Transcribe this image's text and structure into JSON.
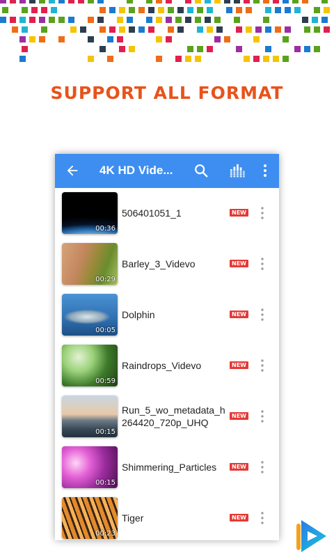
{
  "banner": {
    "headline": "SUPPORT ALL FORMAT"
  },
  "colors": {
    "headline": "#e8531b",
    "appbar": "#3d8ef0",
    "badge": "#e53935",
    "mosaic": [
      "#1a7bd0",
      "#e0204f",
      "#f6c400",
      "#5aa21c",
      "#9b2f9f",
      "#ee6d17",
      "#1fb4d6",
      "#2c3e50"
    ]
  },
  "appbar": {
    "back_icon": "arrow-left-icon",
    "title": "4K HD Vide...",
    "search_icon": "search-icon",
    "equalizer_icon": "equalizer-icon",
    "more_icon": "more-vertical-icon"
  },
  "videos": [
    {
      "name": "506401051_1",
      "duration": "00:36",
      "badge": "NEW",
      "thumb": "earth-from-space"
    },
    {
      "name": "Barley_3_Videvo",
      "duration": "00:29",
      "badge": "NEW",
      "thumb": "hand-in-barley-field"
    },
    {
      "name": "Dolphin",
      "duration": "00:05",
      "badge": "NEW",
      "thumb": "dolphin-underwater"
    },
    {
      "name": "Raindrops_Videvo",
      "duration": "00:59",
      "badge": "NEW",
      "thumb": "green-blur-raindrops"
    },
    {
      "name": "Run_5_wo_metadata_h264420_720p_UHQ",
      "name_lines": [
        "Run_5_wo_metadata_h",
        "264420_720p_UHQ"
      ],
      "duration": "00:15",
      "badge": "NEW",
      "thumb": "city-skyline-sunset"
    },
    {
      "name": "Shimmering_Particles",
      "duration": "00:15",
      "badge": "NEW",
      "thumb": "pink-bokeh-particles"
    },
    {
      "name": "Tiger",
      "duration": "00:23",
      "badge": "NEW",
      "thumb": "tiger"
    }
  ],
  "brand_logo": "play-logo-icon"
}
